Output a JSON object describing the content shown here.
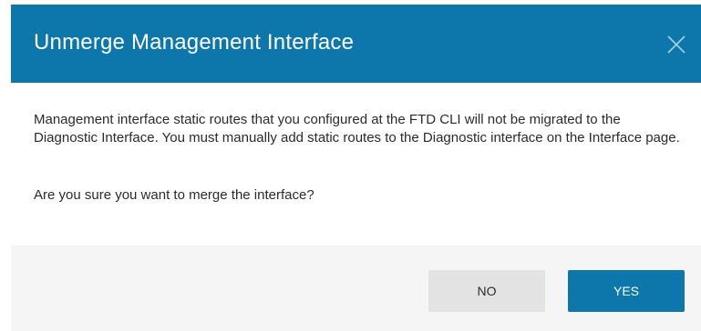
{
  "dialog": {
    "title": "Unmerge Management Interface",
    "close_icon": "close-icon",
    "message": "Management interface static routes that you configured at the FTD CLI will not be migrated to the Diagnostic Interface. You must manually add static routes to the Diagnostic interface on the Interface page.",
    "question": "Are you sure you want to merge the interface?",
    "buttons": {
      "no_label": "NO",
      "yes_label": "YES"
    }
  },
  "colors": {
    "header_bg": "#0d77ab",
    "primary_button": "#0d77ab",
    "secondary_button": "#e3e3e3",
    "footer_bg": "#f5f5f5",
    "text": "#2b2b2b"
  }
}
